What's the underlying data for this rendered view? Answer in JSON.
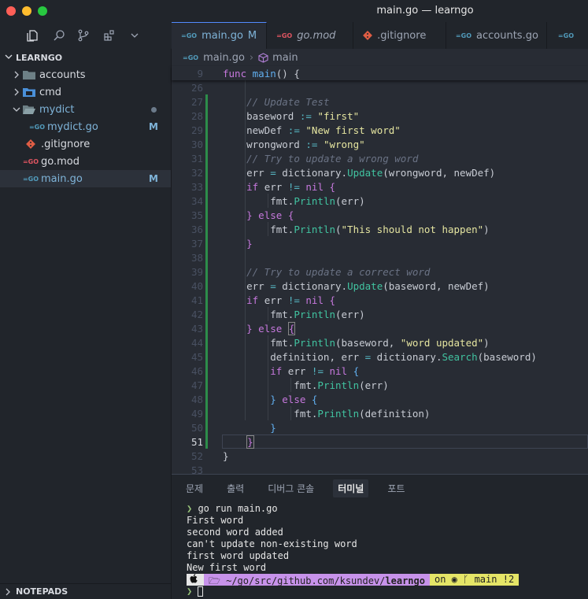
{
  "window": {
    "title": "main.go — learngo"
  },
  "colors": {
    "accent": "#528bff",
    "modified": "#7fb4d9",
    "gutter_modified": "#2d8c4a",
    "git_segment": "#e5e567",
    "path_segment": "#c792ea"
  },
  "activity_icons": [
    "files-icon",
    "search-icon",
    "source-control-icon",
    "extensions-icon",
    "chevron-down-icon"
  ],
  "sidebar": {
    "root": "LEARNGO",
    "items": [
      {
        "label": "accounts",
        "type": "folder",
        "indent": 1
      },
      {
        "label": "cmd",
        "type": "folder-cmd",
        "indent": 1
      },
      {
        "label": "mydict",
        "type": "folder-open",
        "indent": 1
      },
      {
        "label": "mydict.go",
        "type": "go",
        "indent": 2,
        "badge": "M"
      },
      {
        "label": ".gitignore",
        "type": "git",
        "indent": 1
      },
      {
        "label": "go.mod",
        "type": "gomod",
        "indent": 1
      },
      {
        "label": "main.go",
        "type": "go",
        "indent": 1,
        "badge": "M"
      }
    ],
    "footer": "NOTEPADS"
  },
  "tabs": [
    {
      "label": "main.go",
      "flag": "M"
    },
    {
      "label": "go.mod"
    },
    {
      "label": ".gitignore"
    },
    {
      "label": "accounts.go"
    }
  ],
  "breadcrumb": {
    "file": "main.go",
    "symbol": "main"
  },
  "editor": {
    "sticky_line": {
      "number": "9",
      "code": "func main() {"
    },
    "first_line_number": 26,
    "current_line_number": 51
  },
  "panel": {
    "tabs": [
      "문제",
      "출력",
      "디버그 콘솔",
      "터미널",
      "포트"
    ],
    "active_tab": "터미널",
    "terminal": {
      "command": "go run main.go",
      "output": [
        "First word",
        "second word added",
        "can't update non-existing word",
        "first word updated",
        "New first word"
      ],
      "prompt_path_prefix": "~/go/src/github.com/ksundev/",
      "prompt_path_bold": "learngo",
      "git_on": "on",
      "git_branch": "main",
      "git_status": "!2"
    }
  }
}
